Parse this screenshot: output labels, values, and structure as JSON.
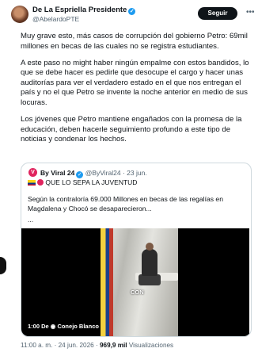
{
  "author": {
    "name": "De La Espriella Presidente",
    "handle": "@AbelardoPTE",
    "verified": true
  },
  "follow_label": "Seguir",
  "body": {
    "paragraphs": [
      "Muy grave esto, más casos de corrupción del gobierno Petro: 69mil millones en becas de las cuales no se registra estudiantes.",
      "A este paso no might haber ningún empalme con estos bandidos, lo que se debe hacer es pedirle que desocupe el cargo y hacer unas auditorías para ver el verdadero estado en el que nos entregan el país y no el que Petro se invente la noche anterior en medio de sus locuras.",
      "Los jóvenes que Petro mantiene engañados con la promesa de la educación, deben hacerle seguimiento profundo a este tipo de noticias y condenar los hechos."
    ]
  },
  "quote": {
    "name": "By Viral 24",
    "handle": "@ByViral24",
    "date": "23 jun.",
    "subtitle": "QUE LO SEPA LA JUVENTUD",
    "text": "Según la contraloría 69.000 Millones en becas de las regalías en Magdalena y Chocó se desaparecieron...",
    "ellipsis": "...",
    "video": {
      "caption": "CON",
      "timer": "1:00",
      "timer_suffix": "De",
      "channel": "Conejo Blanco"
    }
  },
  "footer": {
    "time_date": "11:00 a. m. · 24 jun. 2026 ·",
    "views_count": "969,9 mil",
    "views_label": "Visualizaciones"
  },
  "colors": {
    "verified": "#1d9bf0",
    "muted": "#536471",
    "border": "#cfd9de"
  }
}
